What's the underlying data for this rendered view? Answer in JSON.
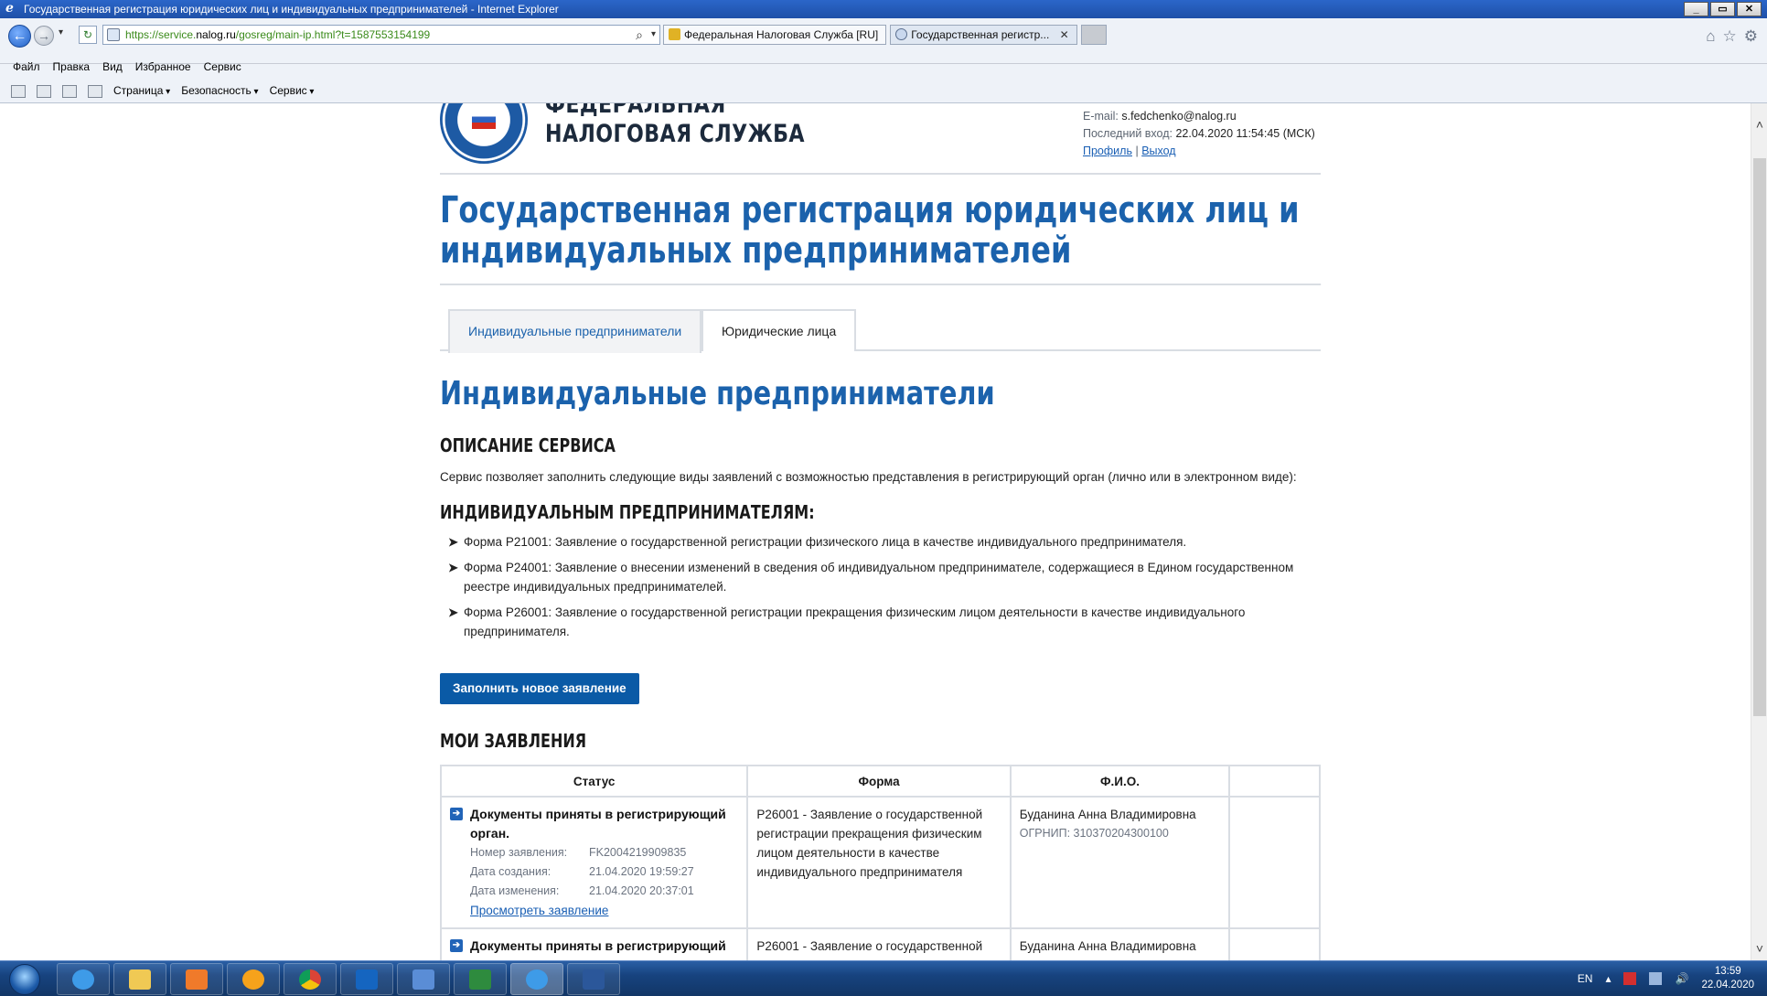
{
  "window": {
    "title": "Государственная регистрация юридических лиц и индивидуальных предпринимателей - Internet Explorer",
    "controls": [
      "_",
      "▭",
      "✕"
    ]
  },
  "browser": {
    "address_prefix": "https://service.",
    "address_host": "nalog.ru",
    "address_path": "/gosreg/main-ip.html?t=1587553154199",
    "tabs": [
      {
        "label": "Федеральная Налоговая Служба [RU]"
      },
      {
        "label": "Государственная регистр...",
        "close": "✕"
      }
    ],
    "menu": [
      "Файл",
      "Правка",
      "Вид",
      "Избранное",
      "Сервис"
    ],
    "commands": [
      "Страница",
      "Безопасность",
      "Сервис"
    ],
    "right_icons": [
      "home-icon",
      "star-icon",
      "gear-icon"
    ]
  },
  "header": {
    "org_line1": "ФЕДЕРАЛЬНАЯ",
    "org_line2": "НАЛОГОВАЯ СЛУЖБА",
    "email_label": "E-mail:",
    "email": "s.fedchenko@nalog.ru",
    "last_login_label": "Последний вход:",
    "last_login": "22.04.2020 11:54:45 (МСК)",
    "profile_link": "Профиль",
    "separator": "|",
    "logout_link": "Выход"
  },
  "page": {
    "title": "Государственная регистрация юридических лиц и индивидуальных предпринимателей",
    "tabs": [
      {
        "label": "Индивидуальные предприниматели",
        "active": true
      },
      {
        "label": "Юридические лица",
        "active": false
      }
    ],
    "section_title": "Индивидуальные предприниматели",
    "description_heading": "ОПИСАНИЕ СЕРВИСА",
    "description_text": "Сервис позволяет заполнить следующие виды заявлений с возможностью представления в регистрирующий орган (лично или в электронном виде):",
    "ip_heading": "ИНДИВИДУАЛЬНЫМ ПРЕДПРИНИМАТЕЛЯМ:",
    "forms": [
      "Форма Р21001: Заявление о государственной регистрации физического лица в качестве индивидуального предпринимателя.",
      "Форма Р24001: Заявление о внесении изменений в сведения об индивидуальном предпринимателе, содержащиеся в Едином государственном реестре индивидуальных предпринимателей.",
      "Форма Р26001: Заявление о государственной регистрации прекращения физическим лицом деятельности в качестве индивидуального предпринимателя."
    ],
    "new_request_button": "Заполнить новое заявление",
    "my_requests_heading": "МОИ ЗАЯВЛЕНИЯ",
    "table": {
      "headers": [
        "Статус",
        "Форма",
        "Ф.И.О.",
        ""
      ],
      "rows": [
        {
          "status": "Документы приняты в регистрирующий орган.",
          "number_label": "Номер заявления:",
          "number": "FK2004219909835",
          "created_label": "Дата создания:",
          "created": "21.04.2020 19:59:27",
          "modified_label": "Дата изменения:",
          "modified": "21.04.2020 20:37:01",
          "view_link": "Просмотреть заявление",
          "form": "Р26001 - Заявление о государственной регистрации прекращения физическим лицом деятельности в качестве индивидуального предпринимателя",
          "name": "Буданина Анна Владимировна",
          "ogrnip": "ОГРНИП: 310370204300100"
        },
        {
          "status": "Документы приняты в регистрирующий",
          "form": "Р26001 - Заявление о государственной",
          "name": "Буданина Анна Владимировна"
        }
      ]
    }
  },
  "taskbar": {
    "lang": "EN",
    "time": "13:59",
    "date": "22.04.2020",
    "apps": [
      "ie-icon",
      "explorer-icon",
      "media-icon",
      "sber-icon",
      "chrome-icon",
      "outlook-icon",
      "network-icon",
      "excel-icon",
      "ie-active-icon",
      "word-icon"
    ]
  },
  "colors": {
    "brand_blue": "#1b62ac",
    "button_blue": "#0a5aa6",
    "link_blue": "#1a5fb4",
    "border_gray": "#d9dde3"
  }
}
